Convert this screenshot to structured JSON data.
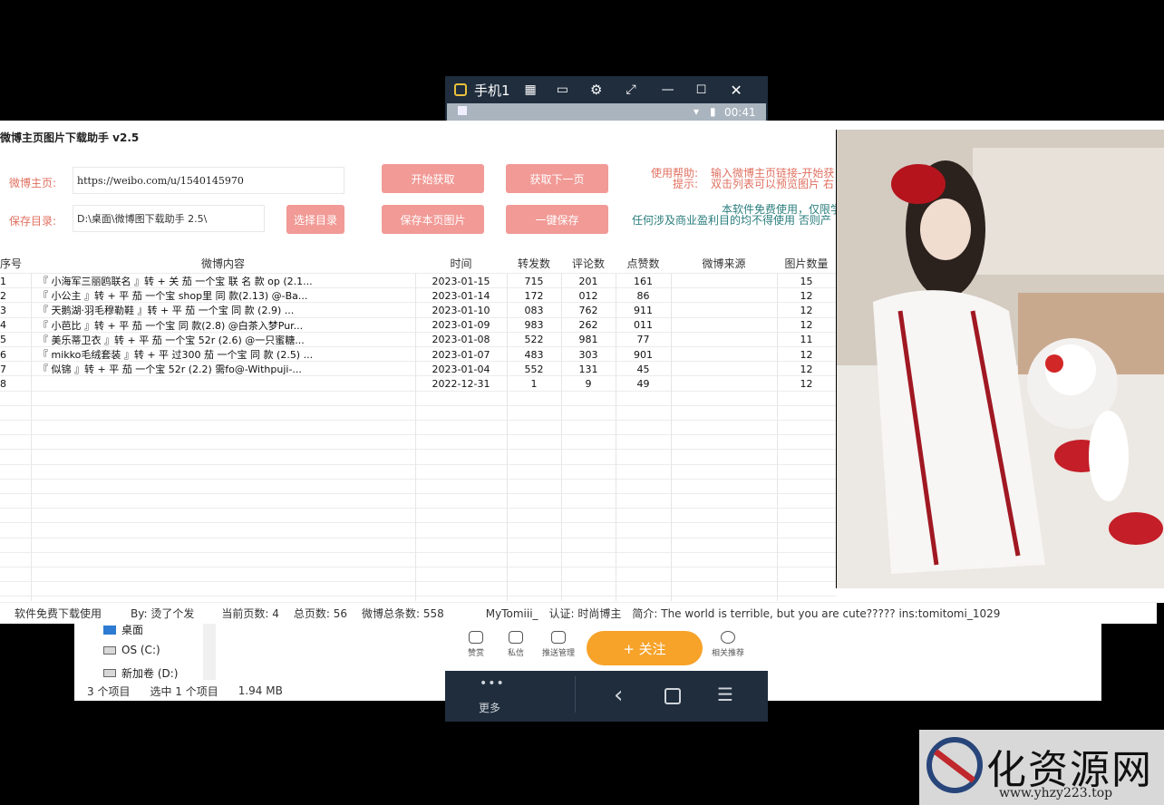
{
  "explorer": {
    "nav_items": [
      "桌面",
      "OS (C:)",
      "新加卷 (D:)"
    ],
    "status": [
      "3 个项目",
      "选中 1 个项目",
      "1.94 MB"
    ]
  },
  "phone": {
    "title": "手机1",
    "time": "00:41",
    "bottom_buttons": [
      "赞赏",
      "私信",
      "推送管理",
      "相关推荐"
    ],
    "follow_label": "+ 关注",
    "more_label": "更多"
  },
  "app": {
    "title": "微博主页图片下载助手 v2.5",
    "homepage_label": "微博主页:",
    "homepage_url": "https://weibo.com/u/1540145970",
    "save_dir_label": "保存目录:",
    "save_dir": "D:\\桌面\\微博图下载助手 2.5\\",
    "buttons": {
      "start": "开始获取",
      "next_page": "获取下一页",
      "choose_dir": "选择目录",
      "save_page": "保存本页图片",
      "one_click_save": "一键保存"
    },
    "help": {
      "usage_label": "使用帮助:",
      "usage_text": "输入微博主页链接-开始获",
      "tip_label": "提示:",
      "tip_text": "双击列表可以预览图片 右",
      "free_notice": "本软件免费使用，仅限学",
      "commercial_notice": "任何涉及商业盈利目的均不得使用 否则产"
    }
  },
  "table": {
    "columns": [
      "序号",
      "微博内容",
      "时间",
      "转发数",
      "评论数",
      "点赞数",
      "微博来源",
      "图片数量"
    ],
    "rows": [
      [
        "1",
        "『 小海军三丽鸥联名 』转 + 关       茄 一个宝 联 名 款 op (2.1...",
        "2023-01-15",
        "715",
        "201",
        "161",
        "",
        "15"
      ],
      [
        "2",
        "『 小公主  』转 + 平       茄 一个宝  shop里 同 款(2.13) @-Ba...",
        "2023-01-14",
        "172",
        "012",
        "86",
        "",
        "12"
      ],
      [
        "3",
        "『 天鹅湖·羽毛穆勒鞋  』转 + 平       茄 一个宝  同 款 (2.9) ...",
        "2023-01-10",
        "083",
        "762",
        "911",
        "",
        "12"
      ],
      [
        "4",
        "『 小芭比  』转 + 平       茄 一个宝  同 款(2.8) @白茶入梦Pur...",
        "2023-01-09",
        "983",
        "262",
        "011",
        "",
        "12"
      ],
      [
        "5",
        "『 美乐蒂卫衣  』转 + 平       茄 一个宝  52r (2.6) @一只蜜糖...",
        "2023-01-08",
        "522",
        "981",
        "77",
        "",
        "11"
      ],
      [
        "6",
        "『 mikko毛绒套装  』转 + 平     过300  茄 一个宝  同 款 (2.5) ...",
        "2023-01-07",
        "483",
        "303",
        "901",
        "",
        "12"
      ],
      [
        "7",
        "『 似锦  』转 + 平       茄 一个宝  52r (2.2) 需fo@-Withpuji-...",
        "2023-01-04",
        "552",
        "131",
        "45",
        "",
        "12"
      ],
      [
        "8",
        "",
        "2022-12-31",
        "1",
        "9",
        "49",
        "",
        "12"
      ]
    ]
  },
  "statusbar": {
    "free": "软件免费下载使用",
    "by": "By: 烫了个发",
    "current_page": "当前页数: 4",
    "total_pages": "总页数: 56",
    "total_posts": "微博总条数: 558",
    "user": "MyTomiii_",
    "verify": "认证: 时尚博主",
    "bio": "简介: The world is terrible, but you are cute????? ins:tomitomi_1029"
  },
  "watermark": {
    "name": "化资源网",
    "url": "www.yhzy223.top"
  }
}
